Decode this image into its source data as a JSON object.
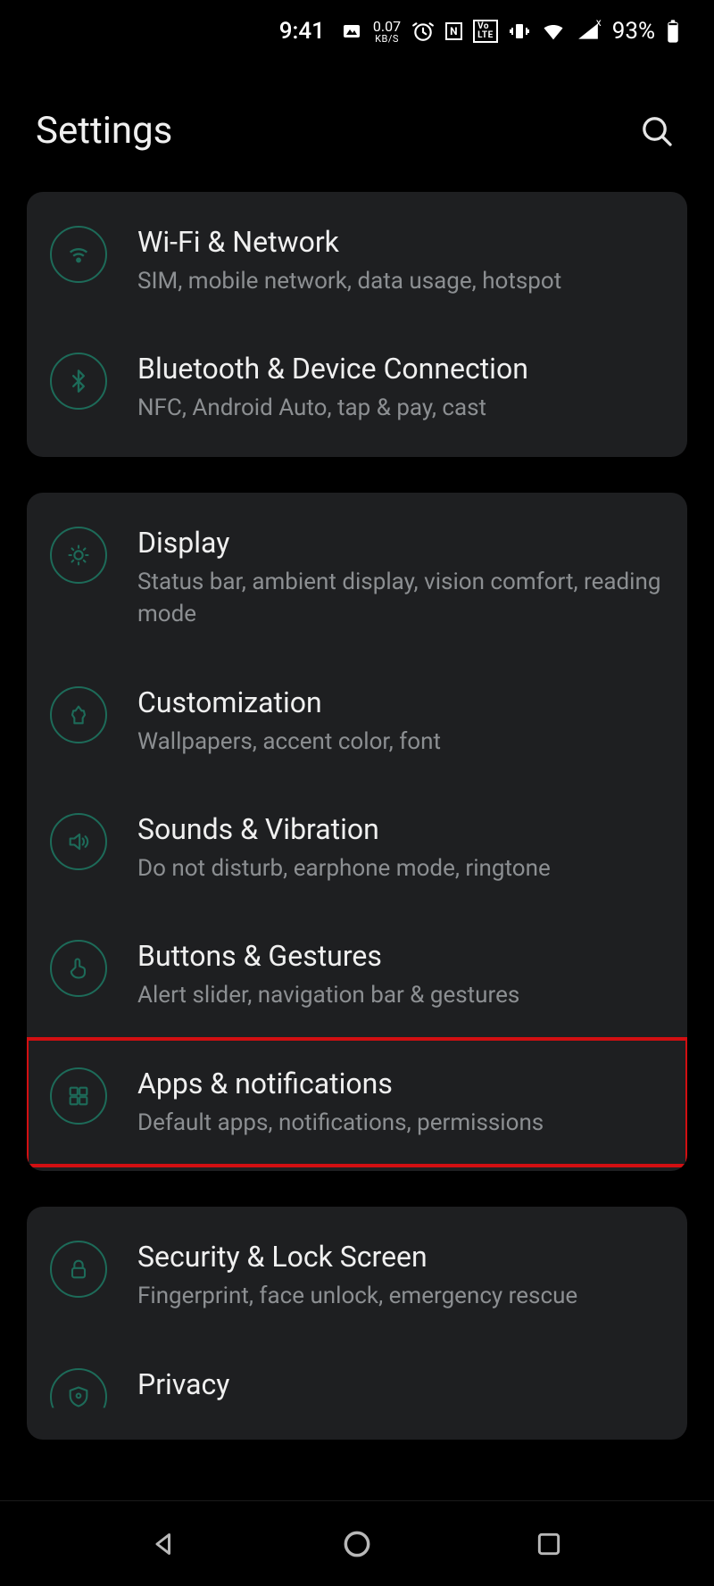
{
  "status": {
    "time": "9:41",
    "net_speed_value": "0.07",
    "net_speed_unit": "KB/S",
    "volte": "VoLTE",
    "nfc": "N",
    "battery_pct": "93%"
  },
  "header": {
    "title": "Settings"
  },
  "accent": "#1d6b59",
  "highlight_color": "#d20f12",
  "groups": [
    {
      "items": [
        {
          "icon": "wifi",
          "title": "Wi-Fi & Network",
          "subtitle": "SIM, mobile network, data usage, hotspot"
        },
        {
          "icon": "bluetooth",
          "title": "Bluetooth & Device Connection",
          "subtitle": "NFC, Android Auto, tap & pay, cast"
        }
      ]
    },
    {
      "items": [
        {
          "icon": "display",
          "title": "Display",
          "subtitle": "Status bar, ambient display, vision comfort, reading mode"
        },
        {
          "icon": "customization",
          "title": "Customization",
          "subtitle": "Wallpapers, accent color, font"
        },
        {
          "icon": "sounds",
          "title": "Sounds & Vibration",
          "subtitle": "Do not disturb, earphone mode, ringtone"
        },
        {
          "icon": "buttons",
          "title": "Buttons & Gestures",
          "subtitle": "Alert slider, navigation bar & gestures"
        },
        {
          "icon": "apps",
          "title": "Apps & notifications",
          "subtitle": "Default apps, notifications, permissions",
          "highlighted": true
        }
      ]
    },
    {
      "items": [
        {
          "icon": "security",
          "title": "Security & Lock Screen",
          "subtitle": "Fingerprint, face unlock, emergency rescue"
        },
        {
          "icon": "privacy",
          "title": "Privacy",
          "subtitle": ""
        }
      ]
    }
  ]
}
